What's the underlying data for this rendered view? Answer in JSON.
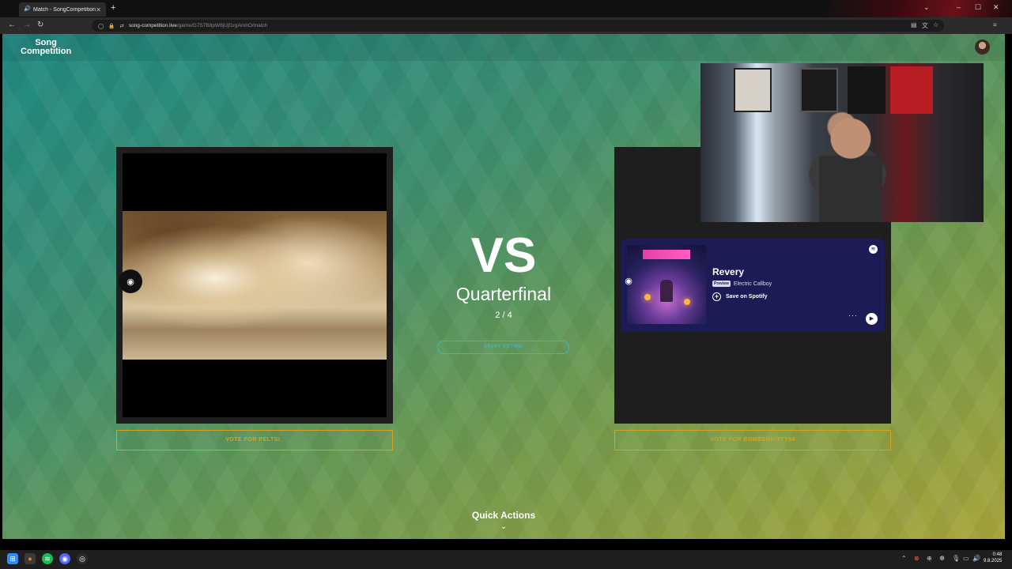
{
  "browser": {
    "tab_title": "Match - SongCompetition",
    "tab_icon": "speaker-icon",
    "new_tab": "+",
    "url_host": "song-competition.live",
    "url_path": "/game/G7S7B8pW8jUjf1rgAmhO/match"
  },
  "site": {
    "logo_line1": "Song",
    "logo_line2": "Competition"
  },
  "match": {
    "vs": "VS",
    "round": "Quarterfinal",
    "progress": "2 / 4",
    "start_voting": "START VOTING",
    "vote_left": "VOTE FOR PELTSI_",
    "vote_right": "VOTE FOR BOMBERKITTY84"
  },
  "spotify": {
    "title": "Revery",
    "badge": "Preview",
    "artist": "Electric Callboy",
    "save": "Save on Spotify",
    "more": "···"
  },
  "quick_actions": {
    "label": "Quick Actions",
    "chevron": "⌄"
  },
  "taskbar": {
    "time": "0:48",
    "date": "9.8.2025"
  },
  "colors": {
    "vote_accent": "#d9a21e",
    "start_accent": "#3fb7c9",
    "spotify_bg": "#1c1b55"
  }
}
